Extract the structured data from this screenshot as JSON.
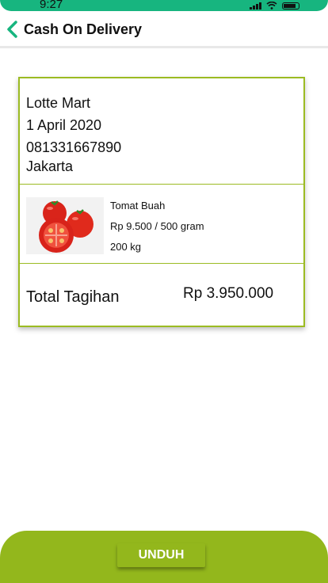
{
  "status_bar": {
    "time": "9:27"
  },
  "header": {
    "title": "Cash On Delivery",
    "back_icon": "chevron-left-icon"
  },
  "order": {
    "store": "Lotte Mart",
    "date": "1 April 2020",
    "phone": "081331667890",
    "city": "Jakarta"
  },
  "product": {
    "name": "Tomat Buah",
    "price": "Rp 9.500 / 500 gram",
    "quantity": "200 kg"
  },
  "total": {
    "label": "Total Tagihan",
    "value": "Rp 3.950.000"
  },
  "actions": {
    "download_label": "UNDUH"
  },
  "colors": {
    "accent": "#93b71c",
    "status": "#17b57f",
    "back_icon": "#17b57f"
  }
}
